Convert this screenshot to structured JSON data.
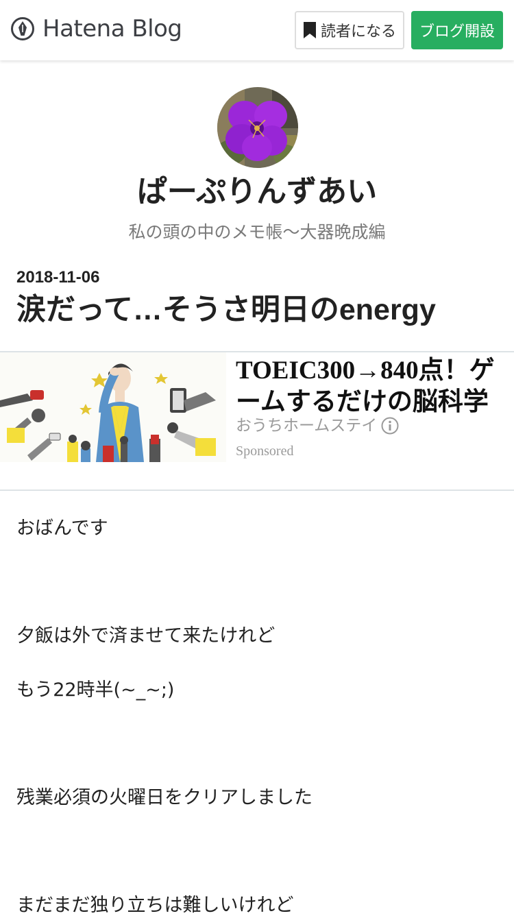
{
  "header": {
    "logo_text": "Hatena Blog",
    "subscribe_label": "読者になる",
    "open_blog_label": "ブログ開設",
    "accent_color": "#27ae60"
  },
  "blog": {
    "title": "ぱーぷりんずあい",
    "description": "私の頭の中のメモ帳～大器晩成編"
  },
  "entry": {
    "date": "2018-11-06",
    "title": "涙だって…そうさ明日のenergy"
  },
  "ad": {
    "headline": "TOEIC300→840点！ゲームするだけの脳科学",
    "source": "おうちホームステイ",
    "sponsored": "Sponsored"
  },
  "body": {
    "paragraphs": [
      "おばんです",
      "夕飯は外で済ませて来たけれど",
      "もう22時半(~_~;)",
      "残業必須の火曜日をクリアしました",
      "まだまだ独り立ちは難しいけれど"
    ]
  }
}
